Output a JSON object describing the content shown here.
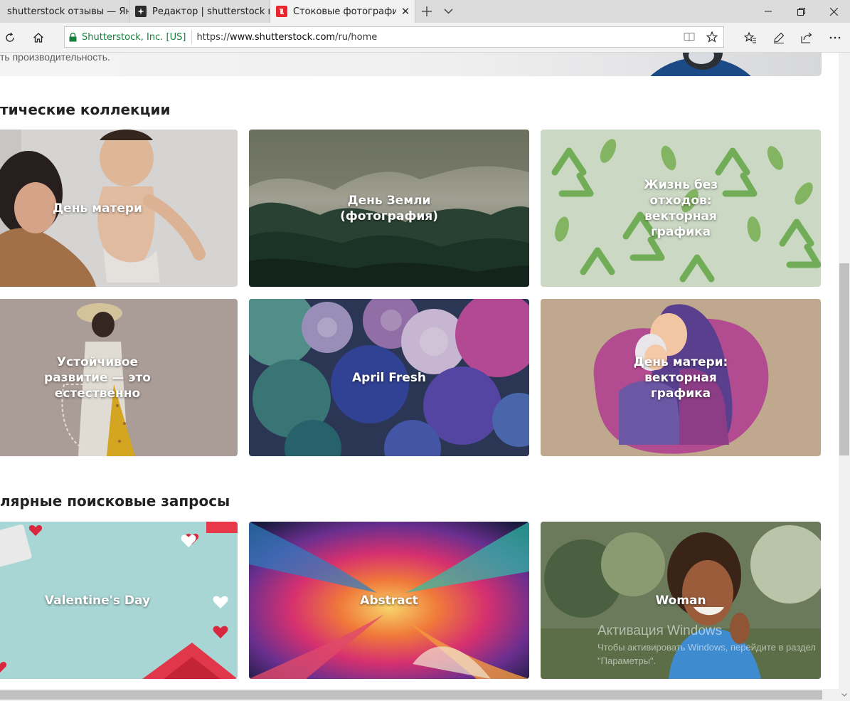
{
  "browser": {
    "tabs": [
      {
        "title": "shutterstock отзывы — Янд",
        "active": false
      },
      {
        "title": "Редактор | shutterstock пре",
        "active": false
      },
      {
        "title": "Стоковые фотографии,",
        "active": true
      }
    ],
    "cert_label": "Shutterstock, Inc. [US]",
    "url_scheme": "https://",
    "url_host": "www.shutterstock.com",
    "url_path": "/ru/home",
    "accent_color": "#15803d"
  },
  "hero": {
    "text": "ть производительность."
  },
  "sections": {
    "collections_title": "тические коллекции",
    "popular_title": "лярные поисковые запросы"
  },
  "collections": [
    {
      "label": "День матери"
    },
    {
      "label": "День Земли (фотография)"
    },
    {
      "label": "Жизнь без отходов: векторная графика"
    },
    {
      "label": "Устойчивое развитие — это естественно"
    },
    {
      "label": "April Fresh"
    },
    {
      "label": "День матери: векторная графика"
    }
  ],
  "popular": [
    {
      "label": "Valentine's Day"
    },
    {
      "label": "Abstract"
    },
    {
      "label": "Woman"
    }
  ],
  "watermark": {
    "title": "Активация Windows",
    "body": "Чтобы активировать Windows, перейдите в раздел \"Параметры\"."
  }
}
